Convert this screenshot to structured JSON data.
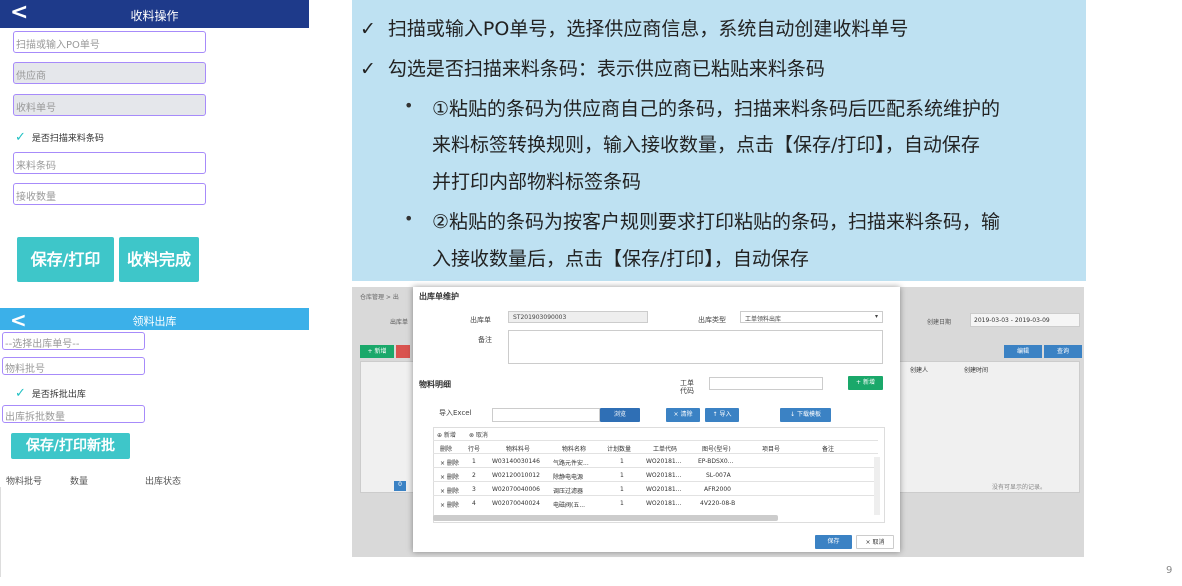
{
  "receive": {
    "title": "收料操作",
    "po_placeholder": "扫描或输入PO单号",
    "supplier_placeholder": "供应商",
    "receipt_no_placeholder": "收料单号",
    "scan_checkbox_label": "是否扫描来料条码",
    "barcode_placeholder": "来料条码",
    "qty_placeholder": "接收数量",
    "save_print_button": "保存/打印",
    "complete_button": "收料完成"
  },
  "issue": {
    "title": "领料出库",
    "select_placeholder": "--选择出库单号--",
    "batch_placeholder": "物料批号",
    "split_checkbox_label": "是否拆批出库",
    "outbound_qty_placeholder": "出库拆批数量",
    "save_print_new_batch_button": "保存/打印新批",
    "table_headers": [
      "物料批号",
      "数量",
      "出库状态"
    ]
  },
  "notes": {
    "line1": "扫描或输入PO单号，选择供应商信息，系统自动创建收料单号",
    "line2": "勾选是否扫描来料条码：表示供应商已粘贴来料条码",
    "bullet1_l1": "①粘贴的条码为供应商自己的条码，扫描来料条码后匹配系统维护的",
    "bullet1_l2": "来料标签转换规则，输入接收数量，点击【保存/打印】，自动保存",
    "bullet1_l3": "并打印内部物料标签条码",
    "bullet2_l1": "②粘贴的条码为按客户规则要求打印粘贴的条码，扫描来料条码，输",
    "bullet2_l2": "入接收数量后，点击【保存/打印】，自动保存",
    "check_glyph": "✓",
    "bullet_glyph": "•"
  },
  "web": {
    "breadcrumb": "仓库管理 > 出",
    "bg_label_outbound": "出库单",
    "bg_label_created": "创建日期",
    "bg_date_range": "2019-03-03 - 2019-03-09",
    "bg_new_button": "+ 新增",
    "bg_edit_button": "编辑",
    "bg_query_button": "查询",
    "bg_col_creator": "创建人",
    "bg_col_created_time": "创建时间",
    "bg_no_records": "没有可显示的记录。",
    "bg_page": "0",
    "modal_title": "出库单维护",
    "label_outbound_no": "出库单",
    "value_outbound_no": "ST201903090003",
    "label_outbound_type": "出库类型",
    "value_outbound_type": "工单领料出库",
    "label_remark": "备注",
    "section_detail": "物料明细",
    "label_work_order": "工单",
    "label_work_order2": "代码",
    "btn_add_detail": "+ 新增",
    "label_import": "导入Excel",
    "btn_browse": "浏览",
    "btn_clear": "× 清除",
    "btn_import": "↑ 导入",
    "btn_download_template": "↓ 下载模板",
    "grid_add": "⊕ 新增",
    "grid_cancel": "⊗ 取消",
    "grid_headers": [
      "删除",
      "行号",
      "物料料号",
      "物料名称",
      "计划数量",
      "工单代码",
      "图号(型号)",
      "项目号",
      "备注"
    ],
    "grid_rows": [
      [
        "× 删除",
        "1",
        "W03140030146",
        "气路元件安...",
        "1",
        "WO20181...",
        "EP-BDSX0..."
      ],
      [
        "× 删除",
        "2",
        "W02120010012",
        "除静电电源",
        "1",
        "WO20181...",
        "SL-007A"
      ],
      [
        "× 删除",
        "3",
        "W02070040006",
        "调压过滤器",
        "1",
        "WO20181...",
        "AFR2000"
      ],
      [
        "× 删除",
        "4",
        "W02070040024",
        "电磁阀(五...",
        "1",
        "WO20181...",
        "4V220-08-B"
      ]
    ],
    "btn_save": "保存",
    "btn_cancel": "× 取消"
  },
  "page_number": "9"
}
